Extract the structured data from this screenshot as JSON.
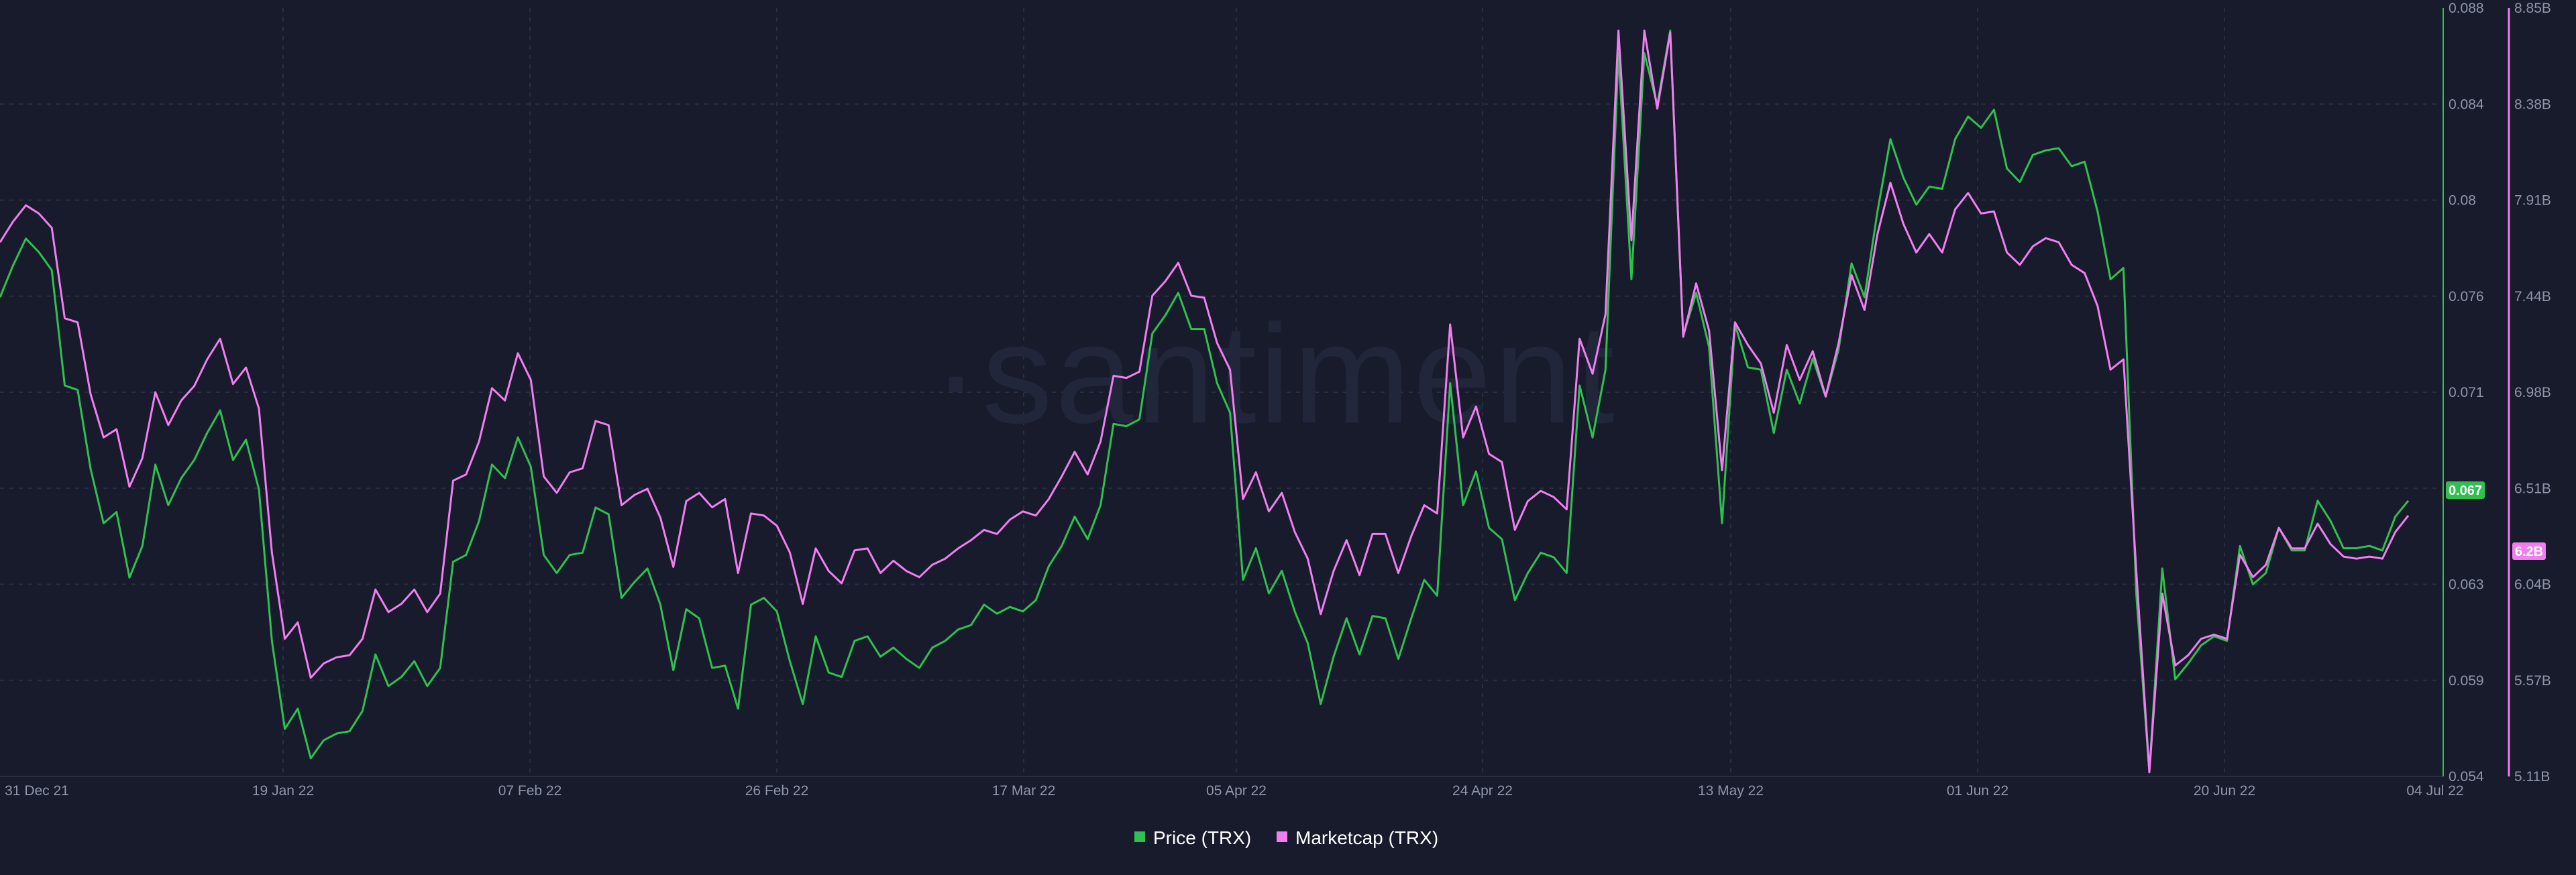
{
  "watermark": "·santiment",
  "colors": {
    "background": "#181b2b",
    "price": "#2fc050",
    "marketcap": "#f07ef0"
  },
  "legend": {
    "price_label": "Price (TRX)",
    "marketcap_label": "Marketcap (TRX)"
  },
  "chart_data": {
    "type": "line",
    "title": "",
    "xlabel": "",
    "x_ticks": [
      "31 Dec 21",
      "19 Jan 22",
      "07 Feb 22",
      "26 Feb 22",
      "17 Mar 22",
      "05 Apr 22",
      "24 Apr 22",
      "13 May 22",
      "01 Jun 22",
      "20 Jun 22",
      "04 Jul 22"
    ],
    "y_left": {
      "label": "",
      "ylim": [
        0.054,
        0.088
      ],
      "ticks": [
        "0.088",
        "0.084",
        "0.08",
        "0.076",
        "0.071",
        "0.067",
        "0.063",
        "0.059",
        "0.054"
      ],
      "current_value": "0.067"
    },
    "y_right": {
      "label": "",
      "ylim": [
        5.11,
        8.85
      ],
      "ticks": [
        "8.85B",
        "8.38B",
        "7.91B",
        "7.44B",
        "6.98B",
        "6.51B",
        "6.04B",
        "5.57B",
        "5.11B"
      ],
      "current_value": "6.2B"
    },
    "grid": true,
    "legend_position": "bottom-center",
    "series": [
      {
        "name": "Price (TRX)",
        "axis": "left",
        "values": [
          0.0752,
          0.0766,
          0.0778,
          0.0772,
          0.0764,
          0.0713,
          0.0711,
          0.0676,
          0.0652,
          0.0657,
          0.0628,
          0.0642,
          0.0678,
          0.066,
          0.0672,
          0.068,
          0.0692,
          0.0702,
          0.068,
          0.0689,
          0.0667,
          0.06,
          0.0561,
          0.057,
          0.0548,
          0.0556,
          0.0559,
          0.056,
          0.0569,
          0.0594,
          0.058,
          0.0584,
          0.0591,
          0.058,
          0.0588,
          0.0635,
          0.0638,
          0.0653,
          0.0678,
          0.0672,
          0.069,
          0.0677,
          0.0638,
          0.063,
          0.0638,
          0.0639,
          0.0659,
          0.0656,
          0.0619,
          0.0626,
          0.0632,
          0.0616,
          0.0587,
          0.0614,
          0.061,
          0.0588,
          0.0589,
          0.057,
          0.0616,
          0.0619,
          0.0613,
          0.0591,
          0.0572,
          0.0602,
          0.0586,
          0.0584,
          0.06,
          0.0602,
          0.0593,
          0.0597,
          0.0592,
          0.0588,
          0.0597,
          0.06,
          0.0605,
          0.0607,
          0.0616,
          0.0612,
          0.0615,
          0.0613,
          0.0618,
          0.0633,
          0.0642,
          0.0655,
          0.0645,
          0.066,
          0.0696,
          0.0695,
          0.0698,
          0.0736,
          0.0744,
          0.0754,
          0.0738,
          0.0738,
          0.0714,
          0.0701,
          0.0627,
          0.0641,
          0.0621,
          0.0631,
          0.0613,
          0.0599,
          0.0572,
          0.0593,
          0.061,
          0.0594,
          0.0611,
          0.061,
          0.0592,
          0.061,
          0.0627,
          0.062,
          0.0714,
          0.066,
          0.0675,
          0.065,
          0.0645,
          0.0618,
          0.063,
          0.0639,
          0.0637,
          0.063,
          0.0713,
          0.069,
          0.072,
          0.086,
          0.076,
          0.086,
          0.0837,
          0.087,
          0.0735,
          0.0754,
          0.073,
          0.0652,
          0.074,
          0.0721,
          0.072,
          0.0692,
          0.072,
          0.0705,
          0.0725,
          0.0708,
          0.0729,
          0.0767,
          0.0752,
          0.079,
          0.0822,
          0.0805,
          0.0793,
          0.0801,
          0.08,
          0.0822,
          0.0832,
          0.0827,
          0.0835,
          0.0809,
          0.0803,
          0.0815,
          0.0817,
          0.0818,
          0.081,
          0.0812,
          0.079,
          0.076,
          0.0765,
          0.062,
          0.0542,
          0.0632,
          0.0583,
          0.059,
          0.0598,
          0.0602,
          0.06,
          0.0642,
          0.0625,
          0.063,
          0.065,
          0.064,
          0.064,
          0.0662,
          0.0653,
          0.0641,
          0.0641,
          0.0642,
          0.064,
          0.0655,
          0.0662
        ]
      },
      {
        "name": "Marketcap (TRX)",
        "axis": "right",
        "values": [
          7.71,
          7.81,
          7.89,
          7.85,
          7.78,
          7.34,
          7.32,
          6.97,
          6.76,
          6.8,
          6.52,
          6.66,
          6.98,
          6.82,
          6.94,
          7.01,
          7.14,
          7.24,
          7.02,
          7.1,
          6.9,
          6.2,
          5.78,
          5.86,
          5.59,
          5.66,
          5.69,
          5.7,
          5.78,
          6.02,
          5.91,
          5.95,
          6.02,
          5.91,
          6.0,
          6.55,
          6.58,
          6.74,
          7.0,
          6.94,
          7.17,
          7.04,
          6.57,
          6.49,
          6.59,
          6.61,
          6.84,
          6.82,
          6.43,
          6.48,
          6.51,
          6.37,
          6.13,
          6.45,
          6.49,
          6.42,
          6.46,
          6.1,
          6.39,
          6.38,
          6.33,
          6.2,
          5.95,
          6.22,
          6.11,
          6.05,
          6.21,
          6.22,
          6.1,
          6.16,
          6.11,
          6.08,
          6.14,
          6.17,
          6.22,
          6.26,
          6.31,
          6.29,
          6.36,
          6.4,
          6.38,
          6.46,
          6.57,
          6.69,
          6.58,
          6.74,
          7.06,
          7.05,
          7.08,
          7.45,
          7.52,
          7.61,
          7.45,
          7.44,
          7.22,
          7.09,
          6.46,
          6.59,
          6.4,
          6.49,
          6.3,
          6.17,
          5.9,
          6.11,
          6.26,
          6.09,
          6.29,
          6.29,
          6.1,
          6.28,
          6.43,
          6.39,
          7.31,
          6.76,
          6.91,
          6.68,
          6.64,
          6.31,
          6.45,
          6.5,
          6.47,
          6.41,
          7.24,
          7.07,
          7.36,
          8.74,
          7.72,
          8.74,
          8.36,
          8.73,
          7.25,
          7.51,
          7.28,
          6.6,
          7.32,
          7.21,
          7.12,
          6.88,
          7.21,
          7.04,
          7.18,
          6.96,
          7.22,
          7.55,
          7.38,
          7.75,
          8.0,
          7.8,
          7.66,
          7.75,
          7.66,
          7.87,
          7.95,
          7.85,
          7.86,
          7.66,
          7.6,
          7.69,
          7.73,
          7.71,
          7.6,
          7.56,
          7.4,
          7.09,
          7.14,
          6.1,
          5.13,
          6.0,
          5.65,
          5.7,
          5.78,
          5.8,
          5.78,
          6.19,
          6.08,
          6.14,
          6.32,
          6.22,
          6.22,
          6.34,
          6.24,
          6.18,
          6.17,
          6.18,
          6.17,
          6.3,
          6.38
        ]
      }
    ]
  }
}
